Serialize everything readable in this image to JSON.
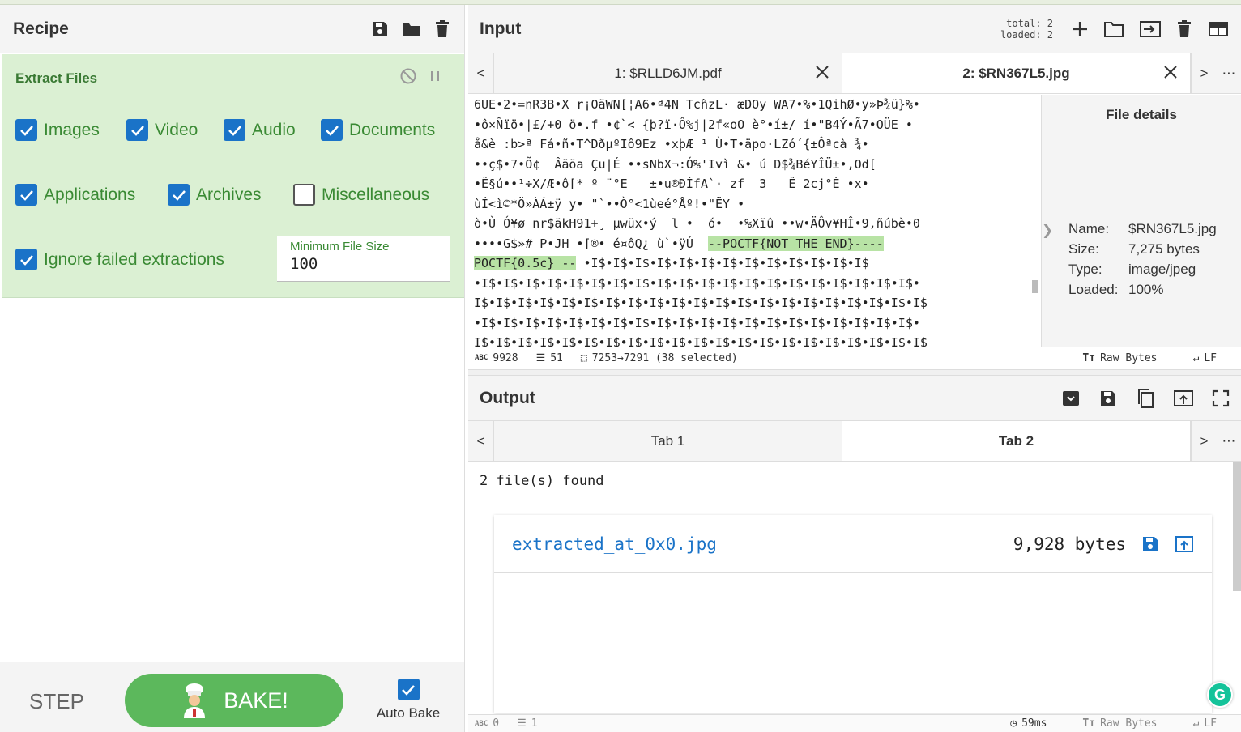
{
  "recipe": {
    "title": "Recipe",
    "operation": {
      "title": "Extract Files",
      "checkboxes": [
        {
          "label": "Images",
          "checked": true
        },
        {
          "label": "Video",
          "checked": true
        },
        {
          "label": "Audio",
          "checked": true
        },
        {
          "label": "Documents",
          "checked": true
        },
        {
          "label": "Applications",
          "checked": true
        },
        {
          "label": "Archives",
          "checked": true
        },
        {
          "label": "Miscellaneous",
          "checked": false
        },
        {
          "label": "Ignore failed extractions",
          "checked": true
        }
      ],
      "min_file_size_label": "Minimum File Size",
      "min_file_size_value": "100"
    },
    "step_label": "STEP",
    "bake_label": "BAKE!",
    "auto_bake_label": "Auto Bake"
  },
  "input": {
    "title": "Input",
    "total_label": "total:",
    "total": "2",
    "loaded_label": "loaded:",
    "loaded": "2",
    "tabs": [
      {
        "label": "1: $RLLD6JM.pdf",
        "active": false
      },
      {
        "label": "2: $RN367L5.jpg",
        "active": true
      }
    ],
    "text_lines": [
      "6UE•2•=nR3B•X r¡OäWN[¦A6•ª4N TcñzL· æDOy WA7•%•1QihØ•y»Þ¾ü}%•",
      "•ô×Ñïö•|£/+0 ö•.f •¢`< {þ?ï·Ô%j|2f«oO è°•í±/ í•\"B4Ý•Ã7•OÜE •",
      "å&è :b>ª Fá•ñ•T^DðµºIô9Ez •xþÆ ¹ Ù•T•äpo·LZó´{±Ôªcà ¾•",
      "••ç$•7•Õ¢  Âäöa Çu|É ••sNbX¬:Ó%'Ivì &• ú D$¾BéYÎÜ±•,Od[",
      "•Ê§ú••¹÷X/Æ•ô[* º ¨°E   ±•u®ÐÌfA`· zf  3   Ê 2cj°É •x•",
      "ùÍ<ì©*Ö»ÀÁ±ÿ y• \"`••Ò°<1ùeé°Åº!•\"ËY •",
      "ò•Ù Ó¥ø nr$äkH91+¸ µwüx•ý  l •  ó•  •%Xïû ••w•ÄÔv¥HÎ•9,ñúbè•0",
      "••••G$»# P•JH •[®• é¤ôQ¿ ù`•ÿÚ  ",
      " ",
      "•I$•I$•I$•I$•I$•I$•I$•I$•I$•I$•I$•I$•I$•I$•I$•I$•I$•I$•I$•I$•",
      "I$•I$•I$•I$•I$•I$•I$•I$•I$•I$•I$•I$•I$•I$•I$•I$•I$•I$•I$•I$•I$",
      "•I$•I$•I$•I$•I$•I$•I$•I$•I$•I$•I$•I$•I$•I$•I$•I$•I$•I$•I$•I$•",
      "I$•I$•I$•I$•I$•I$•I$•I$•I$•I$•I$•I$•I$•I$•I$•I$•I$•I$•I$•I$•I$"
    ],
    "highlight_1": "--POCTF{NOT THE END}----",
    "highlight_2": "POCTF{0.5c} --",
    "line9_after": " •I$•I$•I$•I$•I$•I$•I$•I$•I$•I$•I$•I$•I$",
    "file_details": {
      "title": "File details",
      "name_label": "Name:",
      "name": "$RN367L5.jpg",
      "size_label": "Size:",
      "size": "7,275 bytes",
      "type_label": "Type:",
      "type": "image/jpeg",
      "loaded_label": "Loaded:",
      "loaded": "100%"
    },
    "status": {
      "length": "9928",
      "lines": "51",
      "selection": "7253→7291 (38 selected)",
      "encoding": "Raw Bytes",
      "eol": "LF"
    }
  },
  "output": {
    "title": "Output",
    "tabs": [
      {
        "label": "Tab 1",
        "active": false
      },
      {
        "label": "Tab 2",
        "active": true
      }
    ],
    "found_text": "2 file(s) found",
    "file": {
      "name": "extracted_at_0x0.jpg",
      "size": "9,928 bytes"
    },
    "status": {
      "length": "0",
      "lines": "1",
      "time": "59ms",
      "encoding": "Raw Bytes",
      "eol": "LF"
    }
  },
  "colors": {
    "accent": "#1a73c8",
    "bake": "#5cb85c",
    "operation_bg": "#dbf0d3",
    "label_green": "#3a8a34",
    "highlight": "#b8e3a5"
  }
}
